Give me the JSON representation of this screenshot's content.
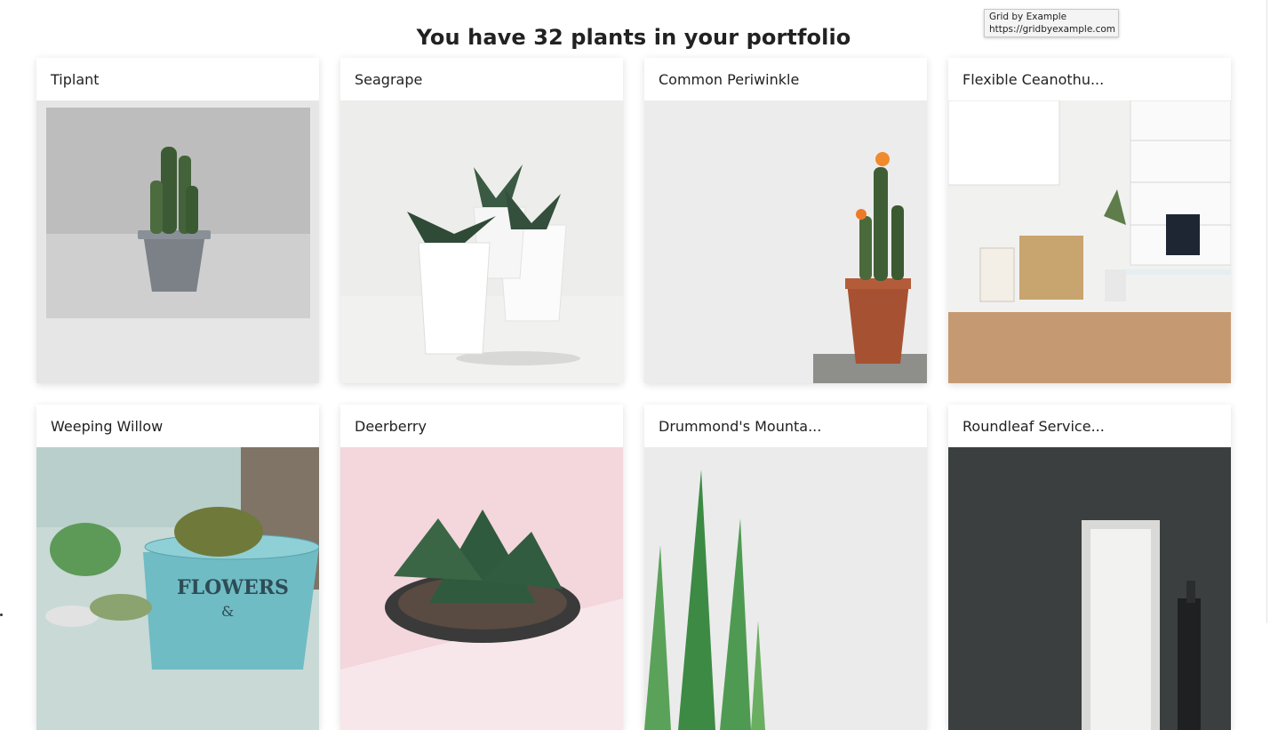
{
  "page": {
    "heading": "You have 32 plants in your portfolio"
  },
  "tooltip": {
    "line1": "Grid by Example",
    "line2": "https://gridbyexample.com"
  },
  "plants": [
    {
      "name": "Tiplant",
      "image": "cactus-grey-pot-photo"
    },
    {
      "name": "Seagrape",
      "image": "succulents-white-pots-photo"
    },
    {
      "name": "Common Periwinkle",
      "image": "flowering-cactus-clay-pot-photo"
    },
    {
      "name": "Flexible Ceanothu...",
      "image": "home-office-room-photo"
    },
    {
      "name": "Weeping Willow",
      "image": "cactus-flowers-tin-photo"
    },
    {
      "name": "Deerberry",
      "image": "succulent-pink-background-photo"
    },
    {
      "name": "Drummond's Mounta...",
      "image": "aloe-leaves-photo"
    },
    {
      "name": "Roundleaf Service...",
      "image": "dark-wall-doorway-photo"
    }
  ]
}
